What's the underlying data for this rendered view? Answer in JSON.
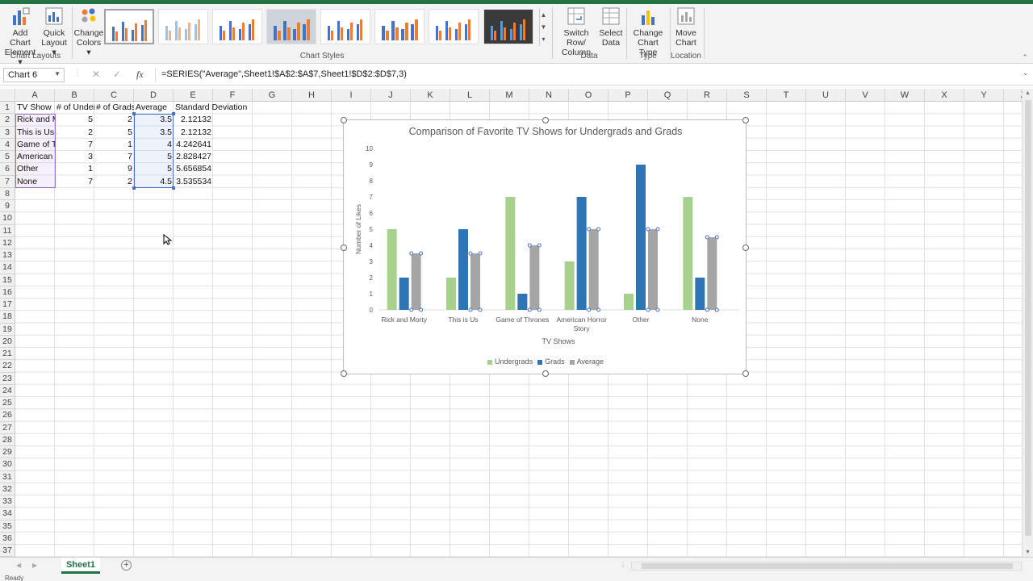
{
  "ribbon": {
    "add_chart_element": [
      "Add Chart",
      "Element ▾"
    ],
    "quick_layout": [
      "Quick",
      "Layout ▾"
    ],
    "change_colors": [
      "Change",
      "Colors ▾"
    ],
    "chart_layouts_label": "Chart Layouts",
    "chart_styles_label": "Chart Styles",
    "switch_row_column": [
      "Switch Row/",
      "Column"
    ],
    "select_data": [
      "Select",
      "Data"
    ],
    "data_label": "Data",
    "change_chart_type": [
      "Change",
      "Chart Type"
    ],
    "type_label": "Type",
    "move_chart": [
      "Move",
      "Chart"
    ],
    "location_label": "Location"
  },
  "formula_bar": {
    "name_box": "Chart 6",
    "formula": "=SERIES(\"Average\",Sheet1!$A$2:$A$7,Sheet1!$D$2:$D$7,3)",
    "fx": "fx"
  },
  "columns": [
    "A",
    "B",
    "C",
    "D",
    "E",
    "F",
    "G",
    "H",
    "I",
    "J",
    "K",
    "L",
    "M",
    "N",
    "O",
    "P",
    "Q",
    "R",
    "S",
    "T",
    "U",
    "V",
    "W",
    "X",
    "Y",
    "Z"
  ],
  "rows": [
    "1",
    "2",
    "3",
    "4",
    "5",
    "6",
    "7",
    "8",
    "9",
    "10",
    "11",
    "12",
    "13",
    "14",
    "15",
    "16",
    "17",
    "18",
    "19",
    "20",
    "21",
    "22",
    "23",
    "24",
    "25",
    "26",
    "27",
    "28",
    "29",
    "30",
    "31",
    "32",
    "33",
    "34",
    "35",
    "36",
    "37"
  ],
  "sheet": {
    "headers": [
      "TV Show",
      "# of Undergrads",
      "# of Grads",
      "Average",
      "Standard Deviation"
    ],
    "data": [
      [
        "Rick and Morty",
        "5",
        "2",
        "3.5",
        "2.12132"
      ],
      [
        "This is Us",
        "2",
        "5",
        "3.5",
        "2.12132"
      ],
      [
        "Game of Thrones",
        "7",
        "1",
        "4",
        "4.242641"
      ],
      [
        "American Horror Story",
        "3",
        "7",
        "5",
        "2.828427"
      ],
      [
        "Other",
        "1",
        "9",
        "5",
        "5.656854"
      ],
      [
        "None",
        "7",
        "2",
        "4.5",
        "3.535534"
      ]
    ]
  },
  "tabs": {
    "sheet1": "Sheet1",
    "add": "+"
  },
  "status": {
    "text": "Ready"
  },
  "colors": {
    "undergrads": "#a9d18e",
    "grads": "#2e75b6",
    "average": "#a5a5a5",
    "excel_green": "#217346"
  },
  "chart_data": {
    "type": "bar",
    "title": "Comparison of Favorite TV Shows for Undergrads and Grads",
    "xlabel": "TV Shows",
    "ylabel": "Number of Likes",
    "categories": [
      "Rick and Morty",
      "This is Us",
      "Game of Thrones",
      "American Horror Story",
      "Other",
      "None"
    ],
    "category_lines": [
      [
        "Rick and Morty"
      ],
      [
        "This is Us"
      ],
      [
        "Game of Thrones"
      ],
      [
        "American Horror",
        "Story"
      ],
      [
        "Other"
      ],
      [
        "None"
      ]
    ],
    "series": [
      {
        "name": "Undergrads",
        "values": [
          5,
          2,
          7,
          3,
          1,
          7
        ],
        "color": "#a9d18e"
      },
      {
        "name": "Grads",
        "values": [
          2,
          5,
          1,
          7,
          9,
          2
        ],
        "color": "#2e75b6"
      },
      {
        "name": "Average",
        "values": [
          3.5,
          3.5,
          4,
          5,
          5,
          4.5
        ],
        "color": "#a5a5a5"
      }
    ],
    "ylim": [
      0,
      10
    ],
    "yticks": [
      0,
      1,
      2,
      3,
      4,
      5,
      6,
      7,
      8,
      9,
      10
    ],
    "grid": false,
    "legend": "bottom",
    "selected_series": "Average"
  }
}
